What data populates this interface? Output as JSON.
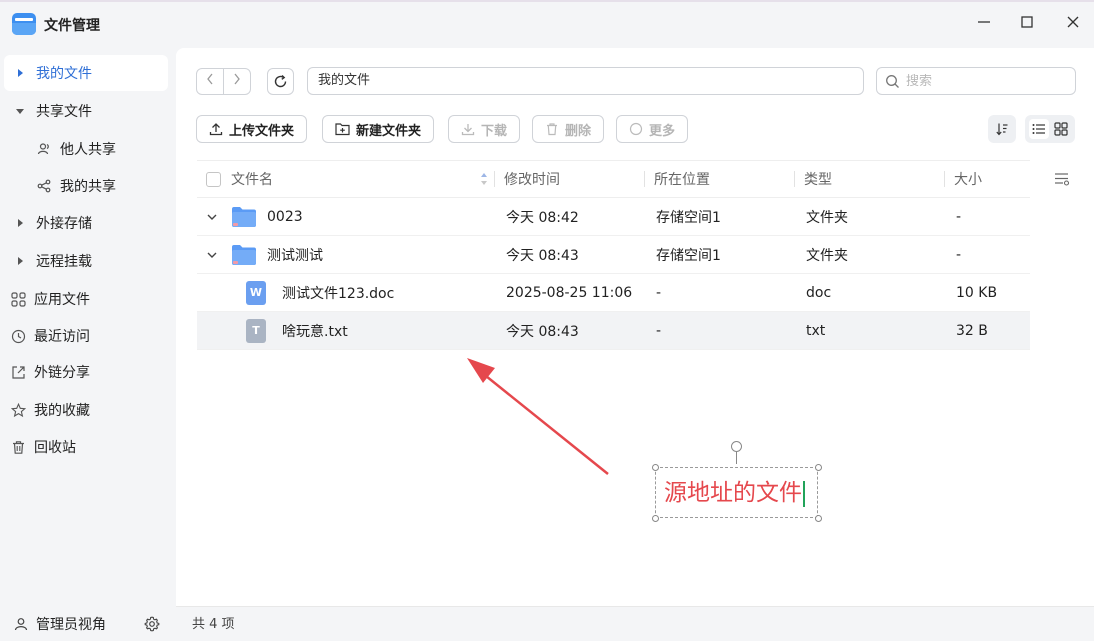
{
  "app": {
    "title": "文件管理"
  },
  "window_controls": {
    "minimize": "—",
    "maximize": "☐",
    "close": "✕"
  },
  "sidebar": {
    "items": [
      {
        "label": "我的文件",
        "icon": "caret-right-icon",
        "active": true
      },
      {
        "label": "共享文件",
        "icon": "caret-down-icon"
      },
      {
        "label": "他人共享",
        "icon": "users-icon",
        "sub": true
      },
      {
        "label": "我的共享",
        "icon": "share-icon",
        "sub": true
      },
      {
        "label": "外接存储",
        "icon": "caret-right-icon"
      },
      {
        "label": "远程挂载",
        "icon": "caret-right-icon"
      },
      {
        "label": "应用文件",
        "icon": "apps-icon"
      },
      {
        "label": "最近访问",
        "icon": "clock-icon"
      },
      {
        "label": "外链分享",
        "icon": "external-share-icon"
      },
      {
        "label": "我的收藏",
        "icon": "star-icon"
      },
      {
        "label": "回收站",
        "icon": "trash-icon"
      }
    ],
    "footer": {
      "label": "管理员视角",
      "icon": "user-icon",
      "settings_icon": "gear-icon"
    }
  },
  "toolbar": {
    "path": "我的文件",
    "search_placeholder": "搜索",
    "upload": "上传文件夹",
    "new_folder": "新建文件夹",
    "download": "下载",
    "delete": "删除",
    "more": "更多"
  },
  "table": {
    "columns": [
      "文件名",
      "修改时间",
      "所在位置",
      "类型",
      "大小"
    ],
    "rows": [
      {
        "name": "0023",
        "modified": "今天 08:42",
        "location": "存储空间1",
        "type": "文件夹",
        "size": "-",
        "kind": "folder"
      },
      {
        "name": "测试测试",
        "modified": "今天 08:43",
        "location": "存储空间1",
        "type": "文件夹",
        "size": "-",
        "kind": "folder"
      },
      {
        "name": "测试文件123.doc",
        "modified": "2025-08-25 11:06",
        "location": "-",
        "type": "doc",
        "size": "10 KB",
        "kind": "doc"
      },
      {
        "name": "啥玩意.txt",
        "modified": "今天 08:43",
        "location": "-",
        "type": "txt",
        "size": "32 B",
        "kind": "txt"
      }
    ]
  },
  "status": {
    "count": "共 4 项"
  },
  "annotation": {
    "text": "源地址的文件",
    "color": "#e5484d"
  },
  "colors": {
    "accent": "#2f6fd6",
    "folder": "#5b9bf5",
    "arrow": "#e5484d"
  }
}
